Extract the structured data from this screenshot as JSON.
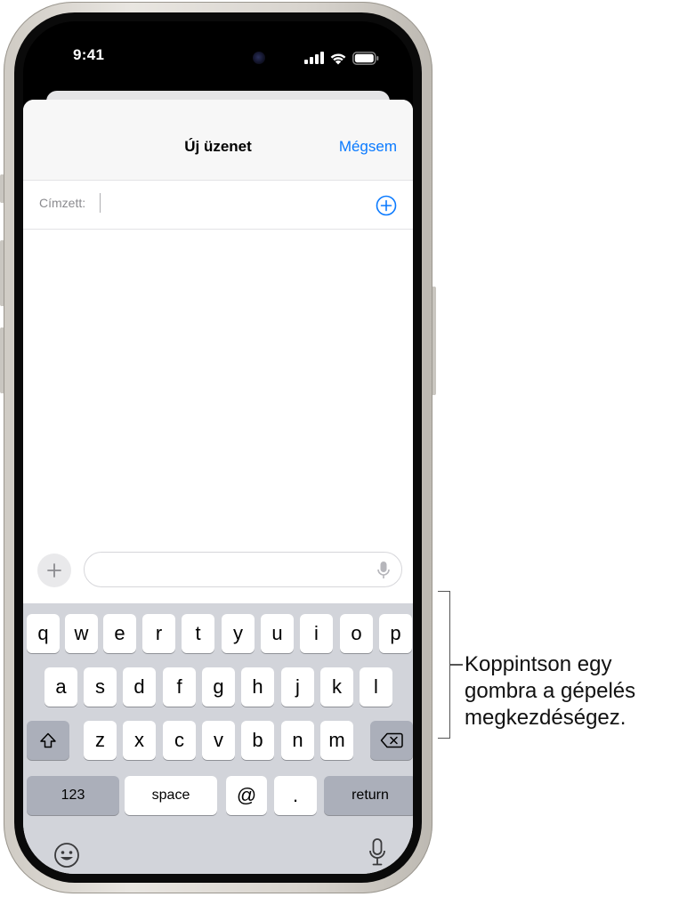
{
  "status_bar": {
    "time": "9:41"
  },
  "compose": {
    "title": "Új üzenet",
    "cancel_label": "Mégsem",
    "to_label": "Címzett:",
    "add_recipient_icon": "plus-circle-icon",
    "attach_icon": "plus-icon",
    "message_placeholder": "",
    "dictation_icon": "microphone-icon"
  },
  "keyboard": {
    "row1": [
      "q",
      "w",
      "e",
      "r",
      "t",
      "y",
      "u",
      "i",
      "o",
      "p"
    ],
    "row2": [
      "a",
      "s",
      "d",
      "f",
      "g",
      "h",
      "j",
      "k",
      "l"
    ],
    "row3": [
      "z",
      "x",
      "c",
      "v",
      "b",
      "n",
      "m"
    ],
    "shift_icon": "shift-icon",
    "delete_icon": "delete-icon",
    "numbers_label": "123",
    "space_label": "space",
    "at_label": "@",
    "period_label": ".",
    "return_label": "return",
    "emoji_icon": "emoji-icon",
    "dictation_icon": "microphone-icon"
  },
  "callout": {
    "text": "Koppintson egy gombra a gépelés megkezdéségez."
  },
  "colors": {
    "accent": "#0a7aff",
    "keyboard_bg": "#d2d4da",
    "key_dark": "#abafba"
  }
}
